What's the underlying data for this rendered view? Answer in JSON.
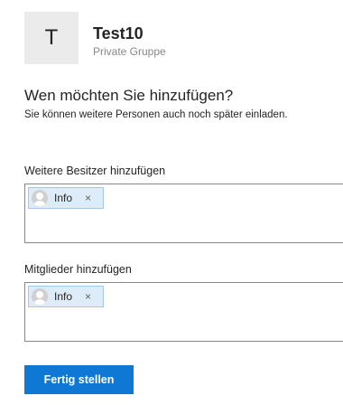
{
  "group": {
    "initial": "T",
    "name": "Test10",
    "privacy": "Private Gruppe"
  },
  "prompt": {
    "title": "Wen möchten Sie hinzufügen?",
    "subtitle": "Sie können weitere Personen auch noch später einladen."
  },
  "owners": {
    "label": "Weitere Besitzer hinzufügen",
    "chips": [
      {
        "name": "Info",
        "avatar_icon": "person-icon",
        "remove_icon": "close-icon",
        "remove_glyph": "×"
      }
    ]
  },
  "members": {
    "label": "Mitglieder hinzufügen",
    "chips": [
      {
        "name": "Info",
        "avatar_icon": "person-icon",
        "remove_icon": "close-icon",
        "remove_glyph": "×"
      }
    ]
  },
  "finish_button": {
    "label": "Fertig stellen"
  },
  "colors": {
    "primary": "#0f78d4",
    "chip_background": "#deecf9",
    "chip_border": "#a6c8e8",
    "avatar_tile": "#ebebeb",
    "muted_text": "#8a8886",
    "field_border": "#8a8886"
  }
}
